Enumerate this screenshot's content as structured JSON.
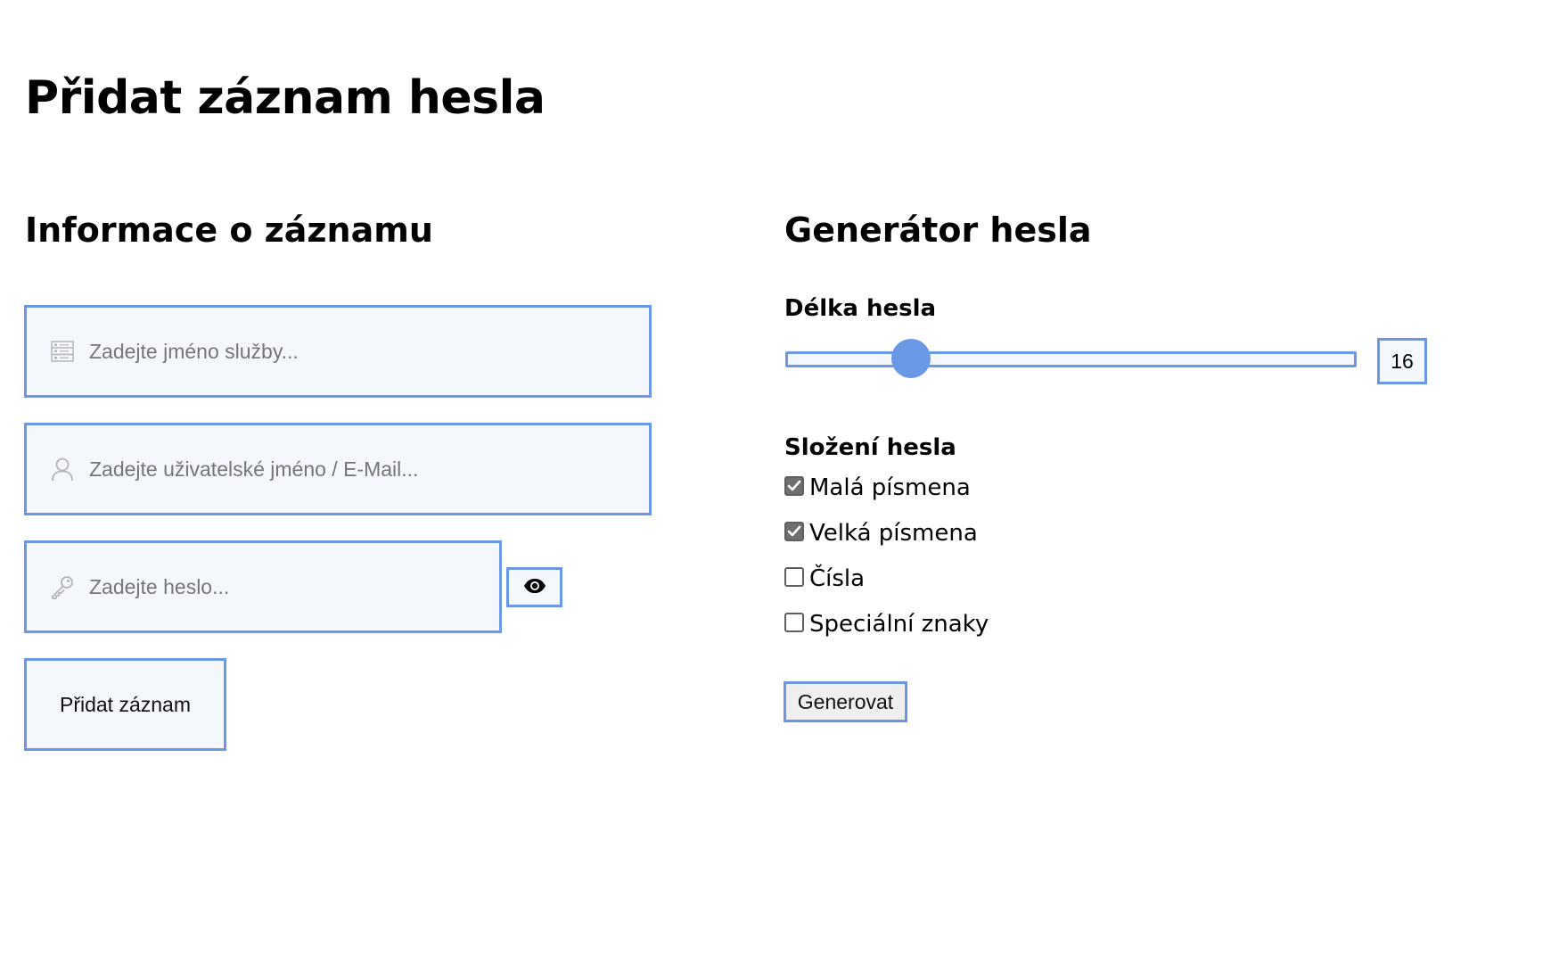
{
  "page": {
    "title": "Přidat záznam hesla"
  },
  "record_info": {
    "heading": "Informace o záznamu",
    "service": {
      "icon": "list-icon",
      "value": "",
      "placeholder": "Zadejte jméno služby..."
    },
    "username": {
      "icon": "user-icon",
      "value": "",
      "placeholder": "Zadejte uživatelské jméno / E-Mail..."
    },
    "password": {
      "icon": "key-icon",
      "value": "",
      "placeholder": "Zadejte heslo..."
    },
    "toggle_visibility_icon": "eye-icon",
    "submit_label": "Přidat záznam"
  },
  "generator": {
    "heading": "Generátor hesla",
    "length_label": "Délka hesla",
    "length_value": "16",
    "slider_fraction": 0.22,
    "composition_label": "Složení hesla",
    "options": [
      {
        "label": "Malá písmena",
        "checked": true
      },
      {
        "label": "Velká písmena",
        "checked": true
      },
      {
        "label": "Čísla",
        "checked": false
      },
      {
        "label": "Speciální znaky",
        "checked": false
      }
    ],
    "generate_label": "Generovat"
  },
  "colors": {
    "accent": "#6a98e6",
    "field_background": "#f4f7fc",
    "checkbox_checked": "#6f6f6f"
  }
}
